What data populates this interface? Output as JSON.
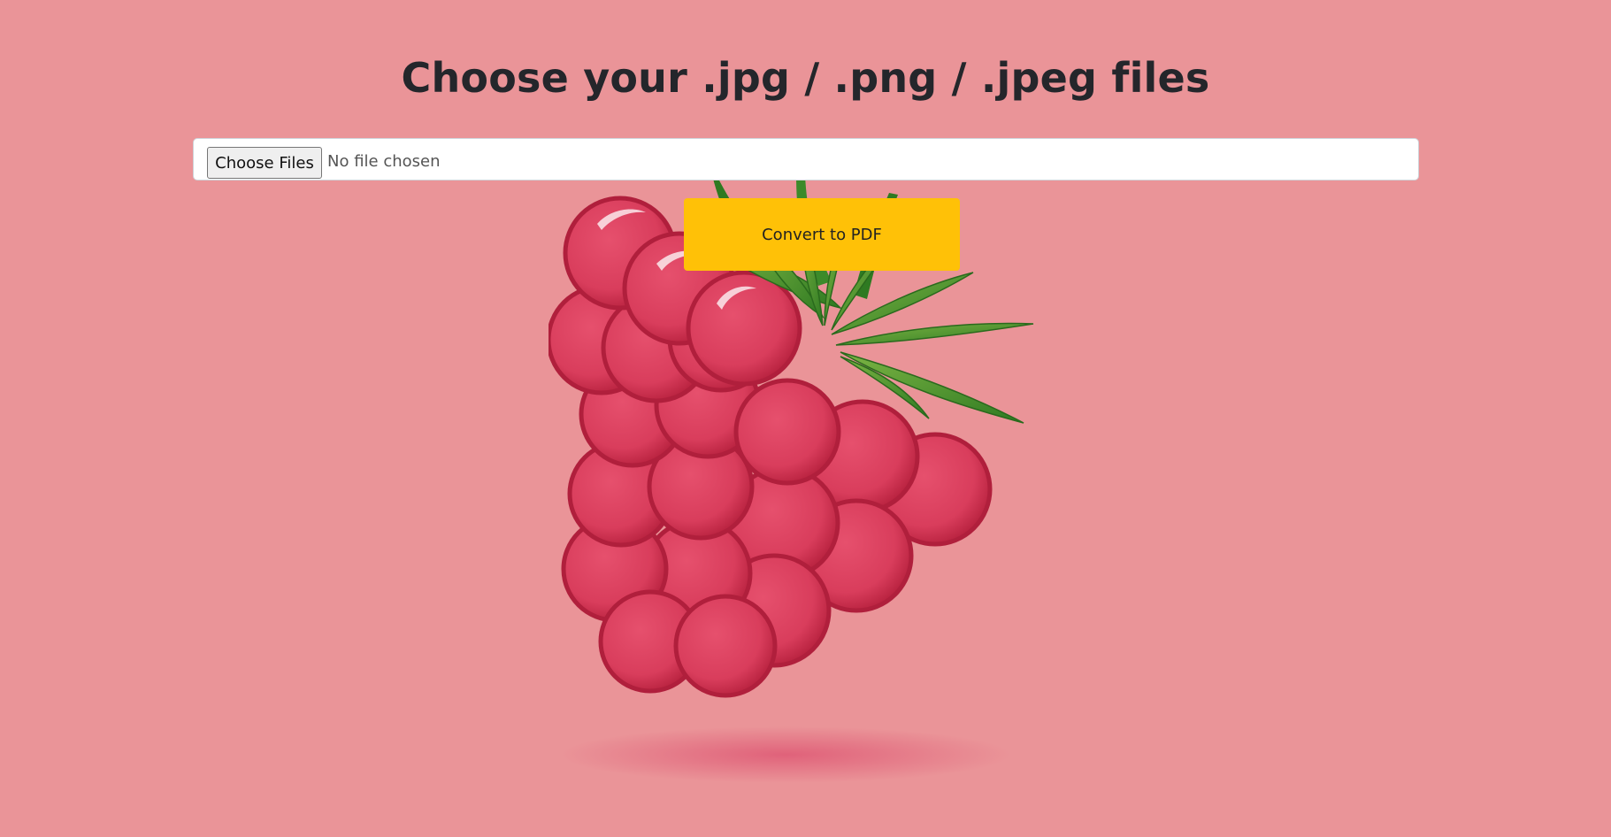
{
  "page": {
    "title": "Choose your .jpg / .png / .jpeg files",
    "background_color": "#ea9498"
  },
  "file_input": {
    "button_label": "Choose Files",
    "status_text": "No file chosen"
  },
  "convert": {
    "label": "Convert to PDF",
    "color": "#ffc107"
  },
  "illustration": {
    "icon": "raspberry-illustration"
  }
}
